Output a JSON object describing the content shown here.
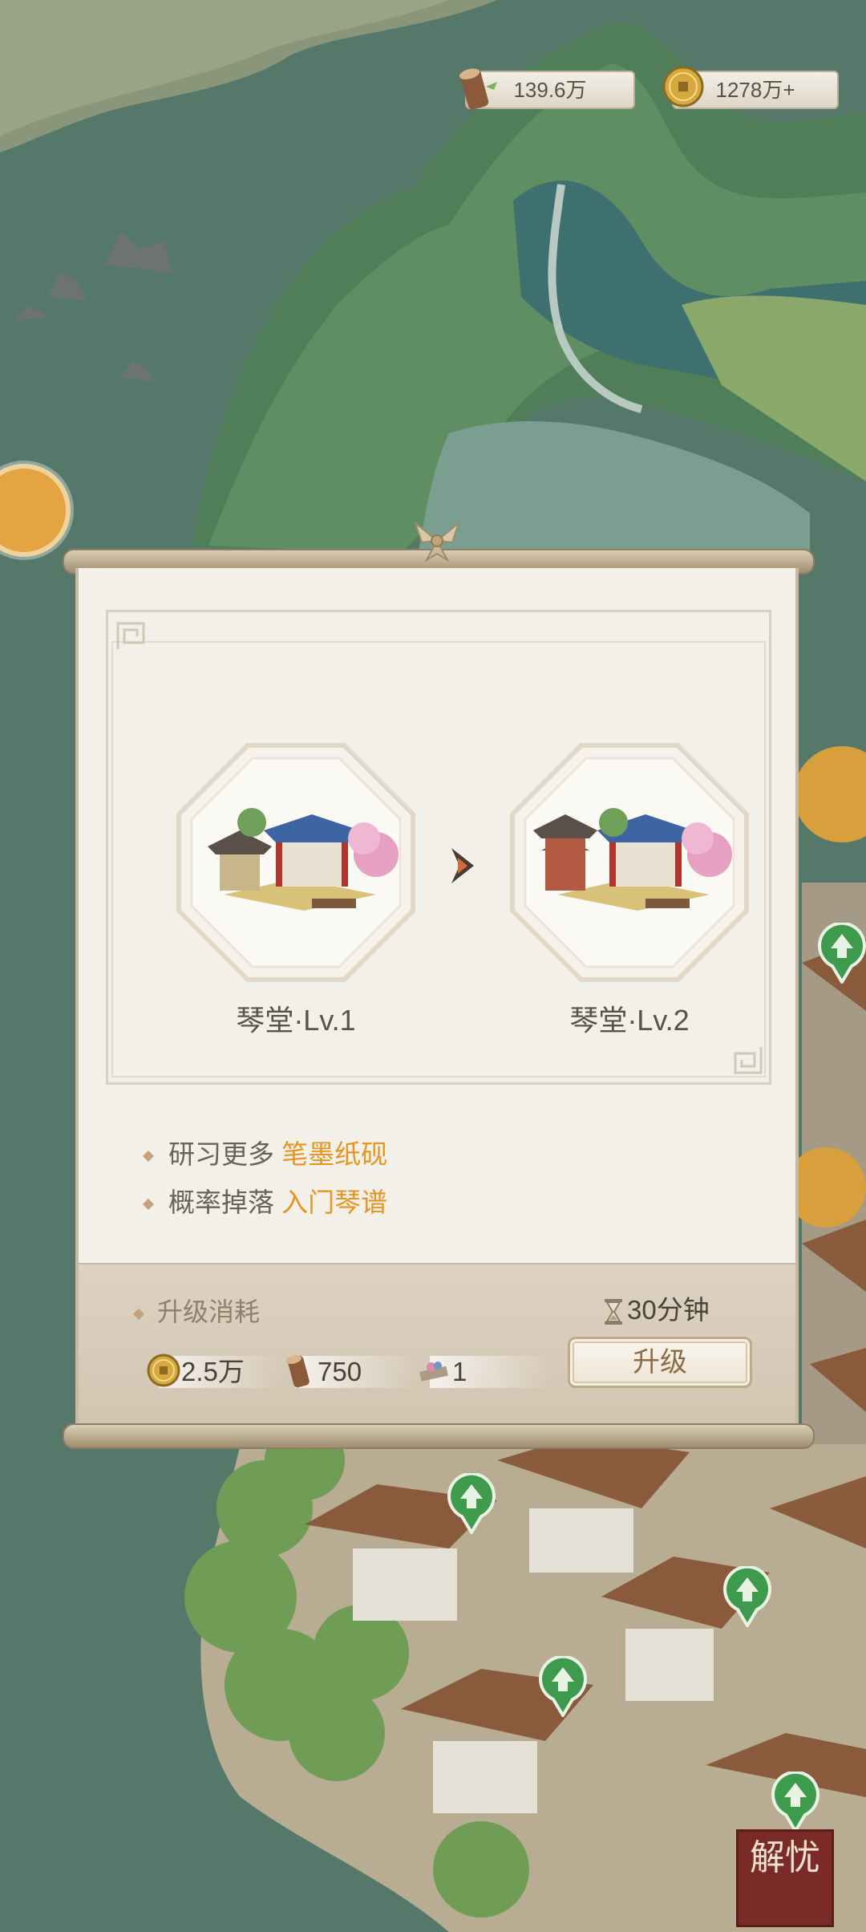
{
  "resources": {
    "wood": "139.6万",
    "coins": "1278万+"
  },
  "dialog": {
    "current_building": "琴堂·Lv.1",
    "next_building": "琴堂·Lv.2",
    "benefits": [
      {
        "prefix": "研习更多 ",
        "highlight": "笔墨纸砚"
      },
      {
        "prefix": "概率掉落 ",
        "highlight": "入门琴谱"
      }
    ],
    "cost_label": "升级消耗",
    "time": "30分钟",
    "costs": {
      "coins": "2.5万",
      "wood": "750",
      "item": "1"
    },
    "upgrade_button": "升级"
  },
  "badge_text": "解忧",
  "icons": [
    "wood-log-icon",
    "coin-icon",
    "hourglass-icon",
    "ribbon-knot-icon",
    "arrow-right-icon",
    "upgrade-arrow-icon"
  ],
  "colors": {
    "highlight": "#e6951f",
    "panel": "#f3f0ea",
    "water": "#55786a",
    "badge": "#7a2b27"
  }
}
